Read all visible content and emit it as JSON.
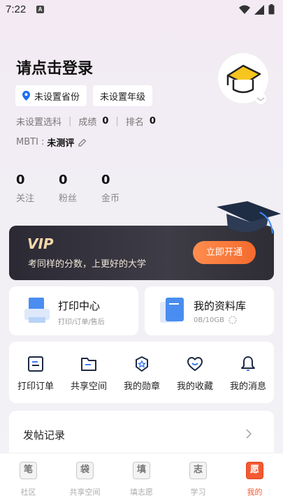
{
  "status": {
    "time": "7:22",
    "notif": "A"
  },
  "profile": {
    "login_prompt": "请点击登录",
    "province": "未设置省份",
    "grade": "未设置年级",
    "subject": "未设置选科",
    "score_label": "成绩",
    "score_value": "0",
    "rank_label": "排名",
    "rank_value": "0",
    "mbti_label": "MBTI :",
    "mbti_value": "未测评"
  },
  "stats": [
    {
      "value": "0",
      "label": "关注"
    },
    {
      "value": "0",
      "label": "粉丝"
    },
    {
      "value": "0",
      "label": "金币"
    }
  ],
  "vip": {
    "logo": "VIP",
    "subtitle": "考同样的分数，上更好的大学",
    "button": "立即开通"
  },
  "cards": {
    "print": {
      "title": "打印中心",
      "sub": "打印/订单/售后"
    },
    "library": {
      "title": "我的资料库",
      "sub": "0B/10GB"
    }
  },
  "actions": [
    {
      "label": "打印订单",
      "icon": "print-order-icon"
    },
    {
      "label": "共享空间",
      "icon": "shared-folder-icon"
    },
    {
      "label": "我的勋章",
      "icon": "medal-icon"
    },
    {
      "label": "我的收藏",
      "icon": "heart-icon"
    },
    {
      "label": "我的消息",
      "icon": "bell-icon"
    }
  ],
  "posts": {
    "title": "发帖记录"
  },
  "tabs": [
    {
      "glyph": "笔",
      "label": "社区"
    },
    {
      "glyph": "袋",
      "label": "共享空间"
    },
    {
      "glyph": "填",
      "label": "填志愿"
    },
    {
      "glyph": "志",
      "label": "学习"
    },
    {
      "glyph": "愿",
      "label": "我的"
    }
  ],
  "colors": {
    "accent": "#f25a32",
    "vip_bg": "#2b2a34",
    "vip_gold": "#f3d7a8"
  }
}
